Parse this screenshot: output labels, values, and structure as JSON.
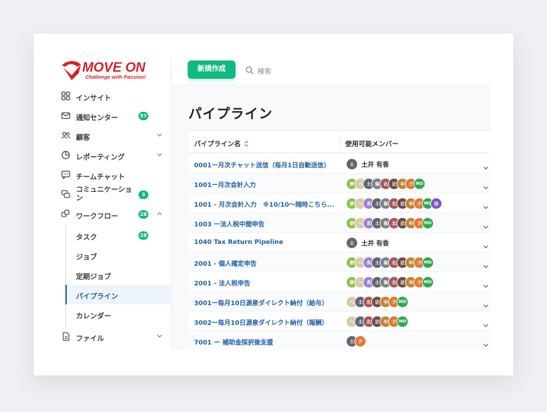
{
  "brand": {
    "name": "MOVE ON",
    "tagline": "Challenge with Passion!",
    "color": "#d2232a"
  },
  "header": {
    "new_button": "新規作成",
    "search_placeholder": "検索"
  },
  "colors": {
    "accent": "#10b981",
    "link": "#1f5fa8"
  },
  "sidebar": {
    "items": [
      {
        "label": "インサイト",
        "icon": "grid-icon"
      },
      {
        "label": "通知センター",
        "icon": "mail-icon",
        "badge": "57"
      },
      {
        "label": "顧客",
        "icon": "users-icon",
        "chevron": "down"
      },
      {
        "label": "レポーティング",
        "icon": "chart-icon",
        "chevron": "down"
      },
      {
        "label": "チームチャット",
        "icon": "chat-icon"
      },
      {
        "label": "コミュニケーション",
        "icon": "comments-icon",
        "badge": "3"
      },
      {
        "label": "ワークフロー",
        "icon": "workflow-icon",
        "badge": "28",
        "chevron": "up"
      },
      {
        "label": "ファイル",
        "icon": "file-icon",
        "chevron": "down"
      }
    ],
    "subitems": [
      {
        "label": "タスク",
        "badge": "28"
      },
      {
        "label": "ジョブ"
      },
      {
        "label": "定期ジョブ"
      },
      {
        "label": "パイプライン",
        "active": true
      },
      {
        "label": "カレンダー"
      }
    ]
  },
  "page": {
    "title": "パイプライン"
  },
  "table": {
    "columns": [
      "パイプライン名",
      "使用可能メンバー"
    ],
    "rows": [
      {
        "name": "0001ー月次チャット送信（毎月1日自動送信）",
        "members": [
          "土"
        ],
        "member_name": "土井 有香"
      },
      {
        "name": "1001ー月次会計入力",
        "members": [
          "野",
          "へ",
          "土",
          "猫",
          "北",
          "近",
          "中",
          "ク",
          "MO"
        ]
      },
      {
        "name": "1001 - 月次会計入力　※10/10〜随時こちら...",
        "members": [
          "野",
          "へ",
          "長",
          "土",
          "猫",
          "北",
          "近",
          "中",
          "ク",
          "MO",
          "田"
        ]
      },
      {
        "name": "1003 ー法人税中間申告",
        "members": [
          "野",
          "へ",
          "長",
          "土",
          "猫",
          "北",
          "近",
          "中",
          "ク",
          "MO"
        ]
      },
      {
        "name": "1040 Tax Return Pipeline",
        "members": [
          "土"
        ],
        "member_name": "土井 有香"
      },
      {
        "name": "2001 - 個人確定申告",
        "members": [
          "野",
          "へ",
          "長",
          "土",
          "猫",
          "北",
          "近",
          "中",
          "ク",
          "MO"
        ]
      },
      {
        "name": "2001 - 法人税申告",
        "members": [
          "野",
          "へ",
          "長",
          "土",
          "猫",
          "北",
          "近",
          "中",
          "ク",
          "MO"
        ]
      },
      {
        "name": "3001ー毎月10日源泉ダイレクト納付（給与）",
        "members": [
          "へ",
          "土",
          "北",
          "近",
          "中",
          "ク",
          "MO"
        ]
      },
      {
        "name": "3002ー毎月10日源泉ダイレクト納付（報酬）",
        "members": [
          "へ",
          "土",
          "北",
          "近",
          "中",
          "ク",
          "MO"
        ]
      },
      {
        "name": "7001 ー 補助金採択後支援",
        "members": [
          "土",
          "ク"
        ]
      }
    ]
  },
  "avatar_colors": {
    "土": "#5f6670",
    "野": "#8bc34a",
    "へ": "#d8c9a8",
    "長": "#9c7fd1",
    "猫": "#7b7f86",
    "北": "#a9555d",
    "近": "#6d4c41",
    "中": "#c0843a",
    "ク": "#e07a3a",
    "MO": "#2fa84f",
    "田": "#7e57c2"
  }
}
